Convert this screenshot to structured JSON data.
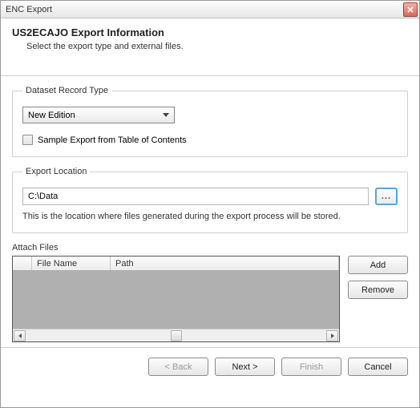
{
  "window": {
    "title": "ENC Export"
  },
  "header": {
    "title": "US2ECAJO Export Information",
    "subtitle": "Select the export type and external files."
  },
  "dataset": {
    "legend": "Dataset Record Type",
    "selected": "New Edition",
    "checkbox_label": "Sample Export from Table of Contents"
  },
  "export_location": {
    "legend": "Export Location",
    "path": "C:\\Data",
    "browse_label": "...",
    "help": "This is the location where files generated during the export process will be stored."
  },
  "attach": {
    "label": "Attach Files",
    "col_filename": "File Name",
    "col_path": "Path",
    "add": "Add",
    "remove": "Remove"
  },
  "footer": {
    "back": "< Back",
    "next": "Next >",
    "finish": "Finish",
    "cancel": "Cancel"
  }
}
